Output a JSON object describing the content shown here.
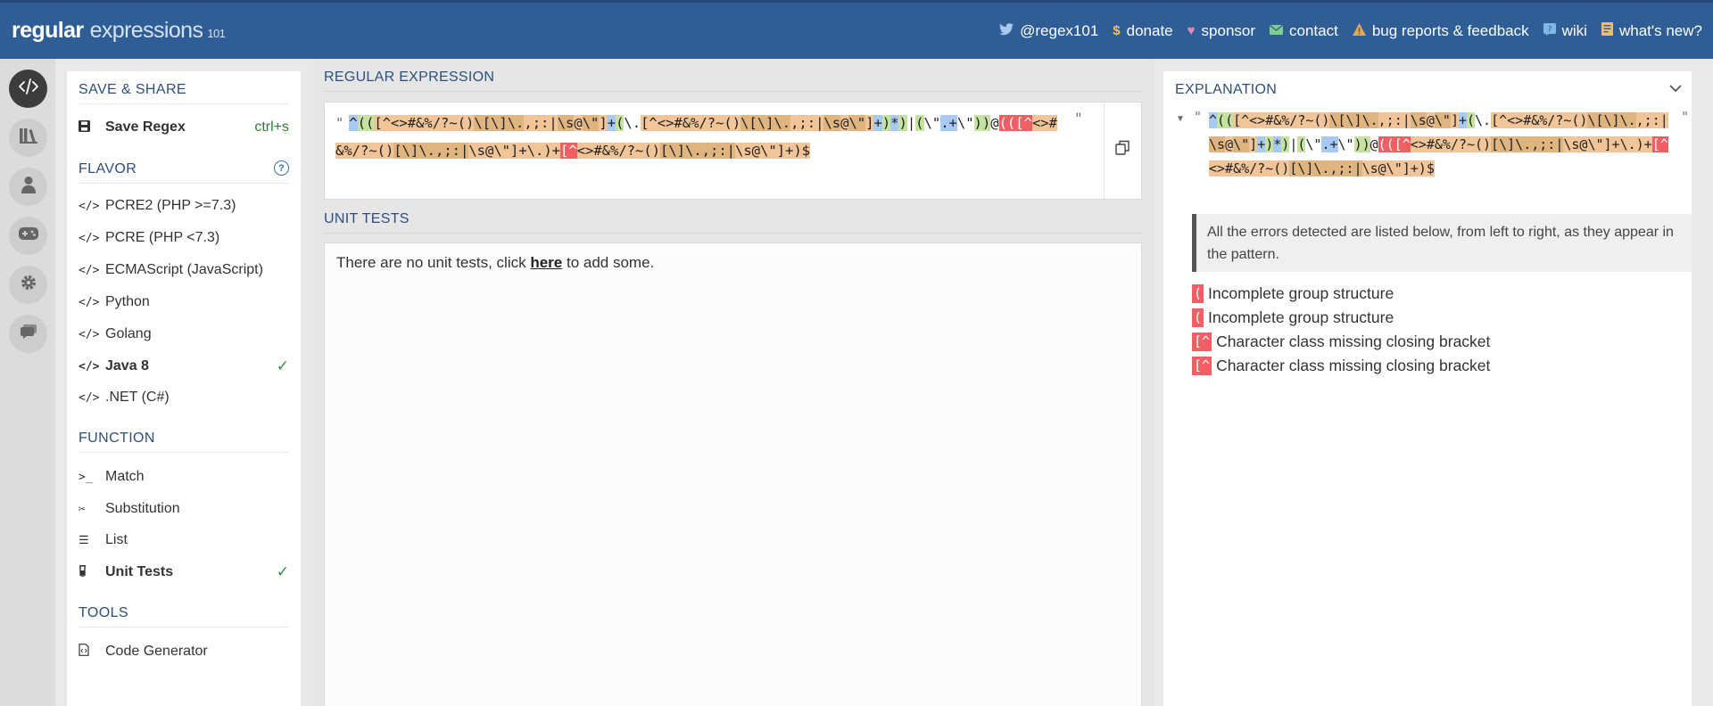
{
  "header": {
    "brand_main": "regular",
    "brand_sub": "expressions",
    "brand_ver": "101",
    "links": [
      {
        "icon": "twitter-icon",
        "label": "@regex101"
      },
      {
        "icon": "dollar-icon",
        "label": "donate"
      },
      {
        "icon": "heart-icon",
        "label": "sponsor"
      },
      {
        "icon": "mail-icon",
        "label": "contact"
      },
      {
        "icon": "warning-icon",
        "label": "bug reports & feedback"
      },
      {
        "icon": "wiki-icon",
        "label": "wiki"
      },
      {
        "icon": "news-icon",
        "label": "what's new?"
      }
    ]
  },
  "rail": [
    "code-icon",
    "library-icon",
    "user-icon",
    "quiz-icon",
    "settings-icon",
    "chat-icon"
  ],
  "sidebar": {
    "save_share_title": "SAVE & SHARE",
    "save_label": "Save Regex",
    "save_shortcut": "ctrl+s",
    "flavor_title": "FLAVOR",
    "flavors": [
      {
        "label": "PCRE2 (PHP >=7.3)",
        "selected": false
      },
      {
        "label": "PCRE (PHP <7.3)",
        "selected": false
      },
      {
        "label": "ECMAScript (JavaScript)",
        "selected": false
      },
      {
        "label": "Python",
        "selected": false
      },
      {
        "label": "Golang",
        "selected": false
      },
      {
        "label": "Java 8",
        "selected": true
      },
      {
        "label": ".NET (C#)",
        "selected": false
      }
    ],
    "function_title": "FUNCTION",
    "functions": [
      {
        "label": "Match",
        "selected": false
      },
      {
        "label": "Substitution",
        "selected": false
      },
      {
        "label": "List",
        "selected": false
      },
      {
        "label": "Unit Tests",
        "selected": true
      }
    ],
    "tools_title": "TOOLS",
    "tools": [
      {
        "label": "Code Generator"
      }
    ]
  },
  "main": {
    "regex_label": "REGULAR EXPRESSION",
    "regex_quote_open": "\"",
    "regex_quote_close": "\"",
    "regex_tokens": [
      {
        "t": "^",
        "c": "b"
      },
      {
        "t": "(",
        "c": "g"
      },
      {
        "t": "(",
        "c": "g"
      },
      {
        "t": "[^<>#&%/?~()",
        "c": "o"
      },
      {
        "t": "\\[",
        "c": "od"
      },
      {
        "t": "\\]",
        "c": "od"
      },
      {
        "t": "\\.",
        "c": "od"
      },
      {
        "t": ",;:|",
        "c": "o"
      },
      {
        "t": "\\s",
        "c": "od"
      },
      {
        "t": "@",
        "c": "o"
      },
      {
        "t": "\\\"",
        "c": "od"
      },
      {
        "t": "]",
        "c": "o"
      },
      {
        "t": "+",
        "c": "b"
      },
      {
        "t": "(",
        "c": "g"
      },
      {
        "t": "\\.",
        "c": "n"
      },
      {
        "t": "[^<>#&%/?~()",
        "c": "o"
      },
      {
        "t": "\\[",
        "c": "od"
      },
      {
        "t": "\\]",
        "c": "od"
      },
      {
        "t": "\\.",
        "c": "od"
      },
      {
        "t": ",;:|",
        "c": "o"
      },
      {
        "t": "\\s",
        "c": "od"
      },
      {
        "t": "@",
        "c": "o"
      },
      {
        "t": "\\\"",
        "c": "od"
      },
      {
        "t": "]",
        "c": "o"
      },
      {
        "t": "+",
        "c": "b"
      },
      {
        "t": ")",
        "c": "g"
      },
      {
        "t": "*",
        "c": "b"
      },
      {
        "t": ")",
        "c": "g"
      },
      {
        "t": "|",
        "c": "n"
      },
      {
        "t": "(",
        "c": "g"
      },
      {
        "t": "\\\"",
        "c": "n"
      },
      {
        "t": ".",
        "c": "b"
      },
      {
        "t": "+",
        "c": "b"
      },
      {
        "t": "\\\"",
        "c": "n"
      },
      {
        "t": ")",
        "c": "g"
      },
      {
        "t": ")",
        "c": "g"
      },
      {
        "t": "@",
        "c": "n"
      },
      {
        "t": "(",
        "c": "r"
      },
      {
        "t": "(",
        "c": "r"
      },
      {
        "t": "[^",
        "c": "r"
      },
      {
        "t": "<>#&%/?~()",
        "c": "o"
      },
      {
        "t": "[\\]\\.,;:|",
        "c": "od"
      },
      {
        "t": "\\s@\\\"]+",
        "c": "o"
      },
      {
        "t": "\\.",
        "c": "o"
      },
      {
        "t": ")+",
        "c": "o"
      },
      {
        "t": "[^",
        "c": "r"
      },
      {
        "t": "<>#&%/?~()",
        "c": "o"
      },
      {
        "t": "[\\]\\.,;:|",
        "c": "od"
      },
      {
        "t": "\\s@\\\"]",
        "c": "o"
      },
      {
        "t": "+)$",
        "c": "o"
      }
    ],
    "unit_tests_label": "UNIT TESTS",
    "unit_tests_text_before": "There are no unit tests, click ",
    "unit_tests_link": "here",
    "unit_tests_text_after": " to add some."
  },
  "explanation": {
    "title": "EXPLANATION",
    "note": "All the errors detected are listed below, from left to right, as they appear in the pattern.",
    "errors": [
      {
        "chip": "(",
        "message": "Incomplete group structure"
      },
      {
        "chip": "(",
        "message": "Incomplete group structure"
      },
      {
        "chip": "[^",
        "message": "Character class missing closing bracket"
      },
      {
        "chip": "[^",
        "message": "Character class missing closing bracket"
      }
    ]
  },
  "colors": {
    "header_bg": "#2f5d96",
    "token_orange": "#f2c598",
    "token_blue": "#a9c9f5",
    "token_green": "#c6e2a0",
    "token_error": "#ef5f63",
    "check_green": "#2e8b3f"
  }
}
